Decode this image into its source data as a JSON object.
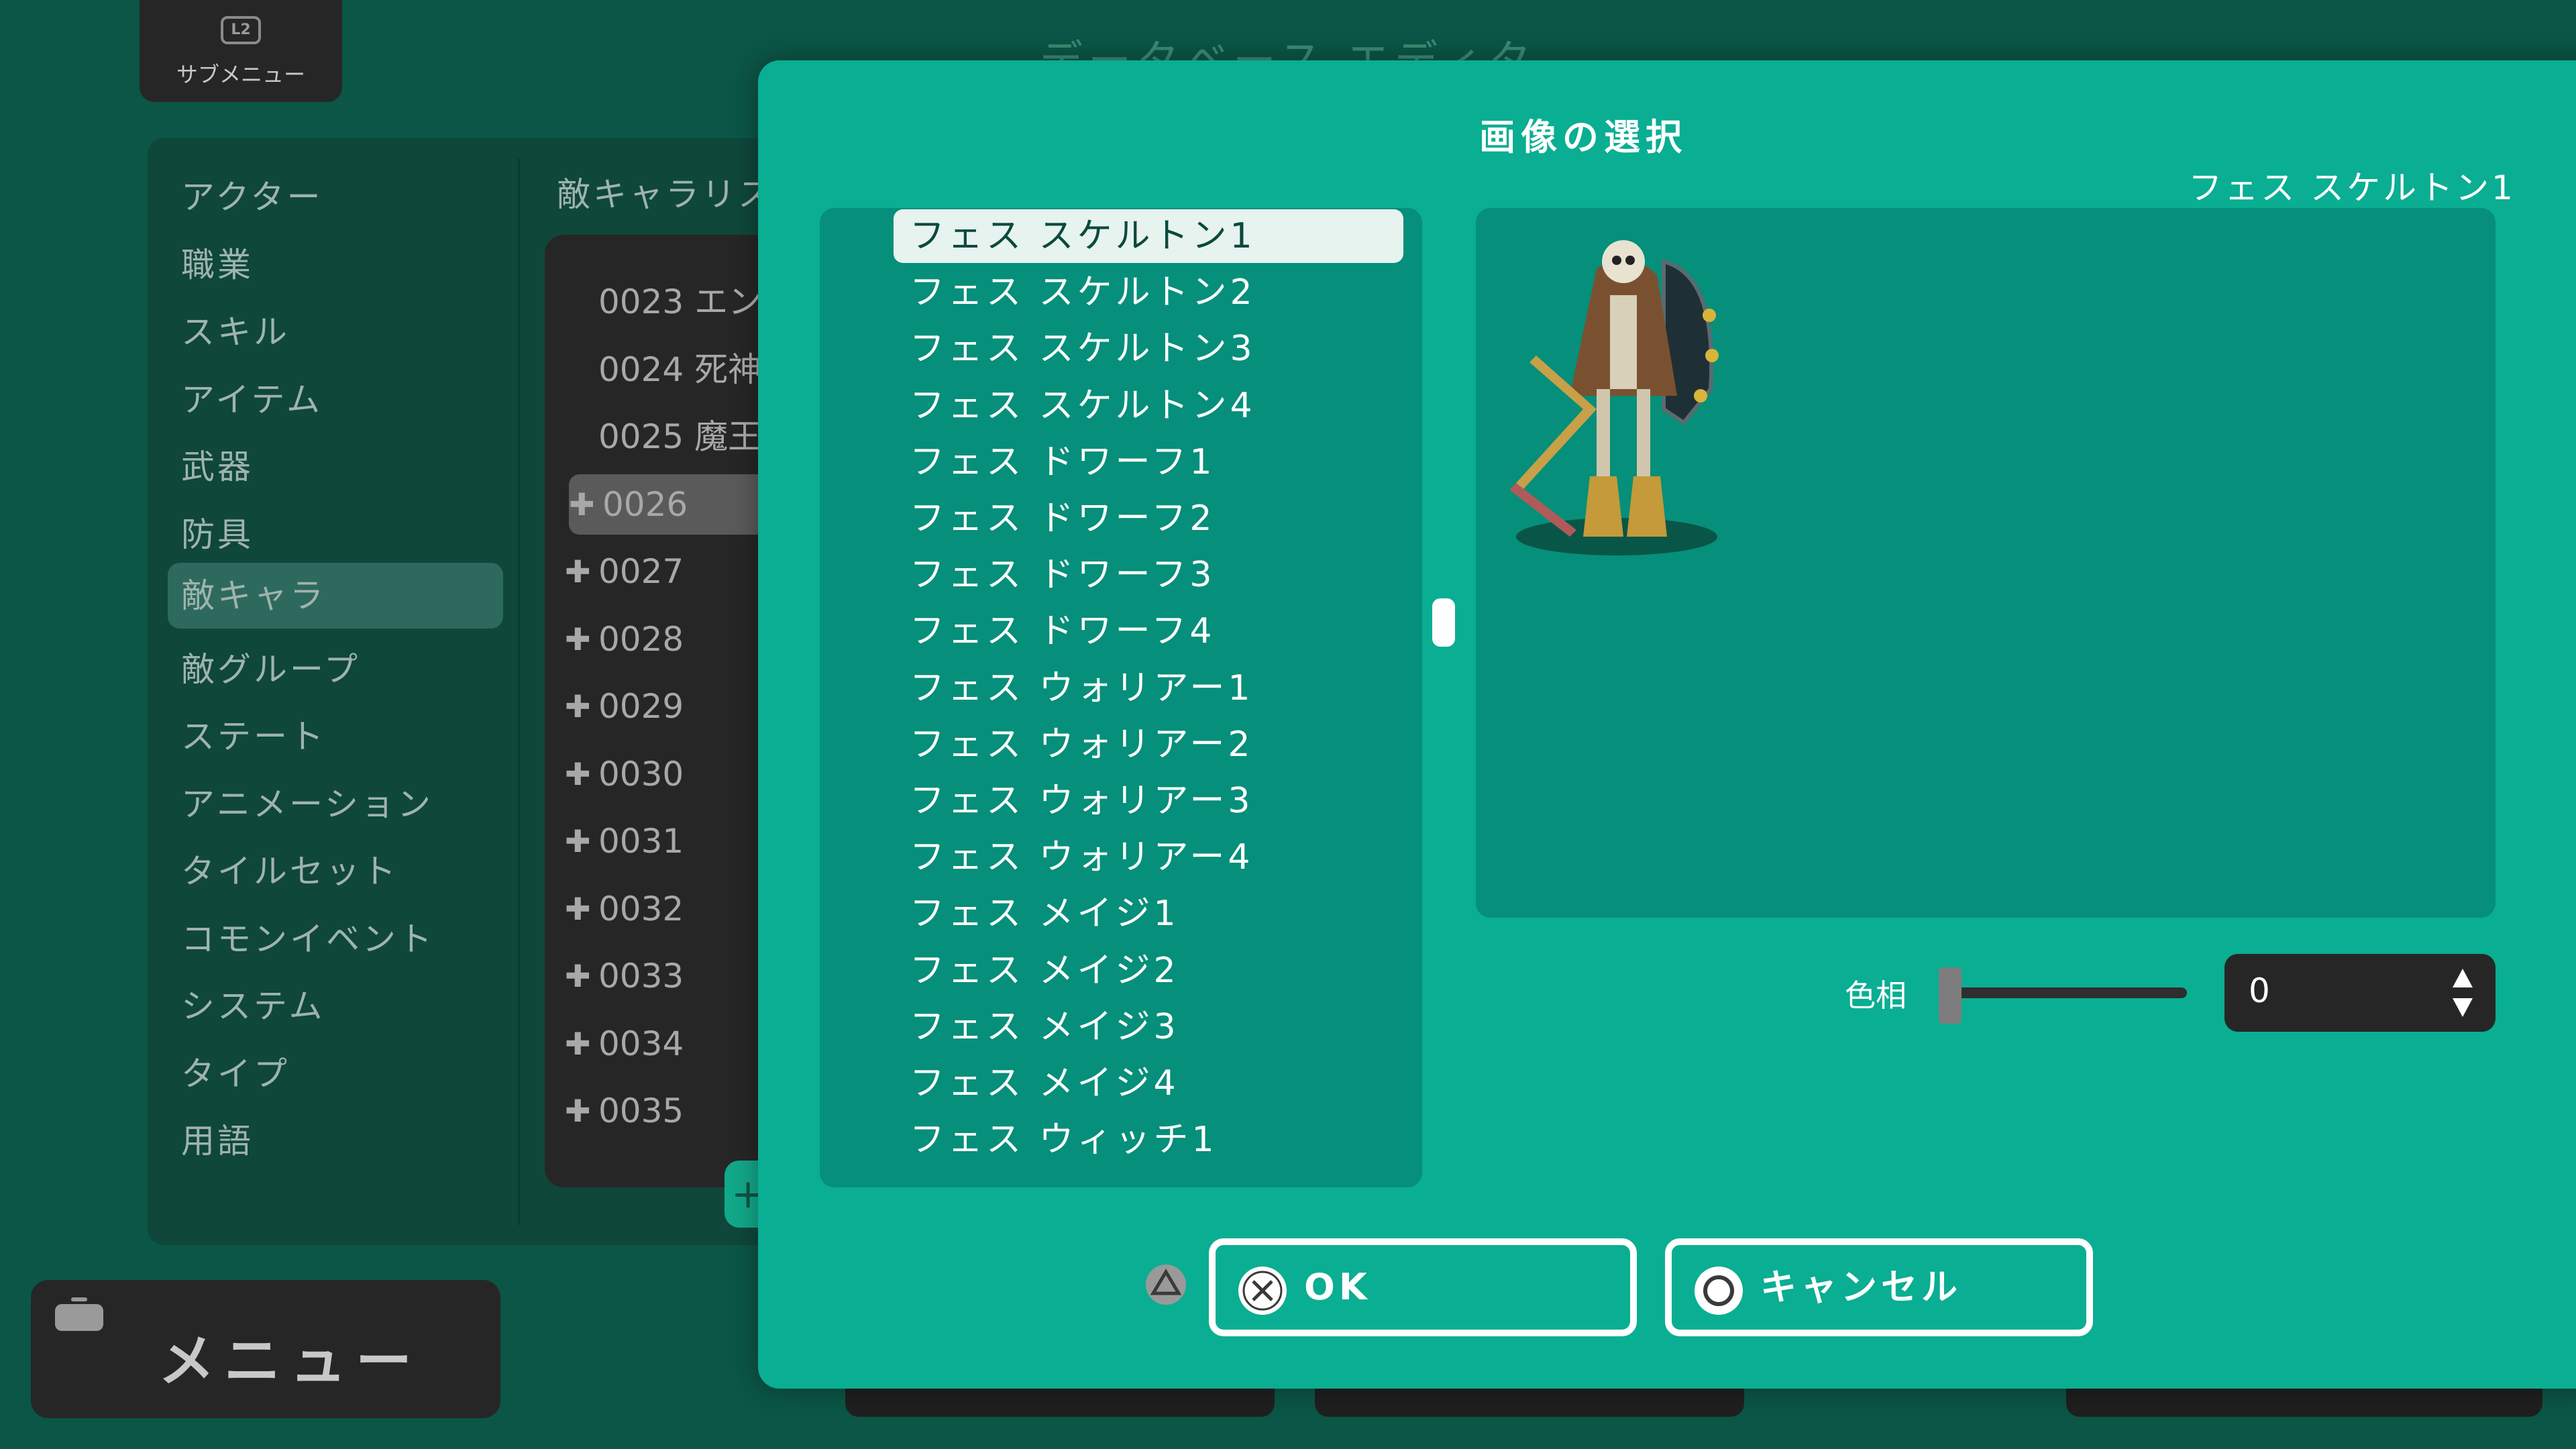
{
  "background": {
    "submenu": {
      "badge": "L2",
      "label": "サブメニュー"
    },
    "title": "データベース エディタ",
    "categories": [
      "アクター",
      "職業",
      "スキル",
      "アイテム",
      "武器",
      "防具",
      "敵キャラ",
      "敵グループ",
      "ステート",
      "アニメーション",
      "タイルセット",
      "コモンイベント",
      "システム",
      "タイプ",
      "用語"
    ],
    "active_category": "敵キャラ",
    "list_header": "敵キャラリスト",
    "enemies": [
      {
        "plus": "",
        "label": "0023 エン"
      },
      {
        "plus": "",
        "label": "0024 死神"
      },
      {
        "plus": "",
        "label": "0025 魔王"
      },
      {
        "plus": "✚",
        "label": "0026"
      },
      {
        "plus": "✚",
        "label": "0027"
      },
      {
        "plus": "✚",
        "label": "0028"
      },
      {
        "plus": "✚",
        "label": "0029"
      },
      {
        "plus": "✚",
        "label": "0030"
      },
      {
        "plus": "✚",
        "label": "0031"
      },
      {
        "plus": "✚",
        "label": "0032"
      },
      {
        "plus": "✚",
        "label": "0033"
      },
      {
        "plus": "✚",
        "label": "0034"
      },
      {
        "plus": "✚",
        "label": "0035"
      }
    ],
    "selected_enemy": "0026",
    "fab_label": "+",
    "menu": {
      "label": "メニュー"
    }
  },
  "dialog": {
    "title": "画像の選択",
    "selected_name": "フェス スケルトン1",
    "images": [
      "フェス スケルトン1",
      "フェス スケルトン2",
      "フェス スケルトン3",
      "フェス スケルトン4",
      "フェス ドワーフ1",
      "フェス ドワーフ2",
      "フェス ドワーフ3",
      "フェス ドワーフ4",
      "フェス ウォリアー1",
      "フェス ウォリアー2",
      "フェス ウォリアー3",
      "フェス ウォリアー4",
      "フェス メイジ1",
      "フェス メイジ2",
      "フェス メイジ3",
      "フェス メイジ4",
      "フェス ウィッチ1"
    ],
    "hue": {
      "label": "色相",
      "value": "0",
      "level": 0
    },
    "buttons": {
      "ok": "OK",
      "cancel": "キャンセル"
    },
    "icons": {
      "triangle": "triangle-button-icon",
      "cross": "cross-button-icon",
      "circle": "circle-button-icon"
    },
    "colors": {
      "dialog_bg": "#0aae92",
      "panel_bg": "#068f7a",
      "app_bg": "#0b5646"
    }
  }
}
